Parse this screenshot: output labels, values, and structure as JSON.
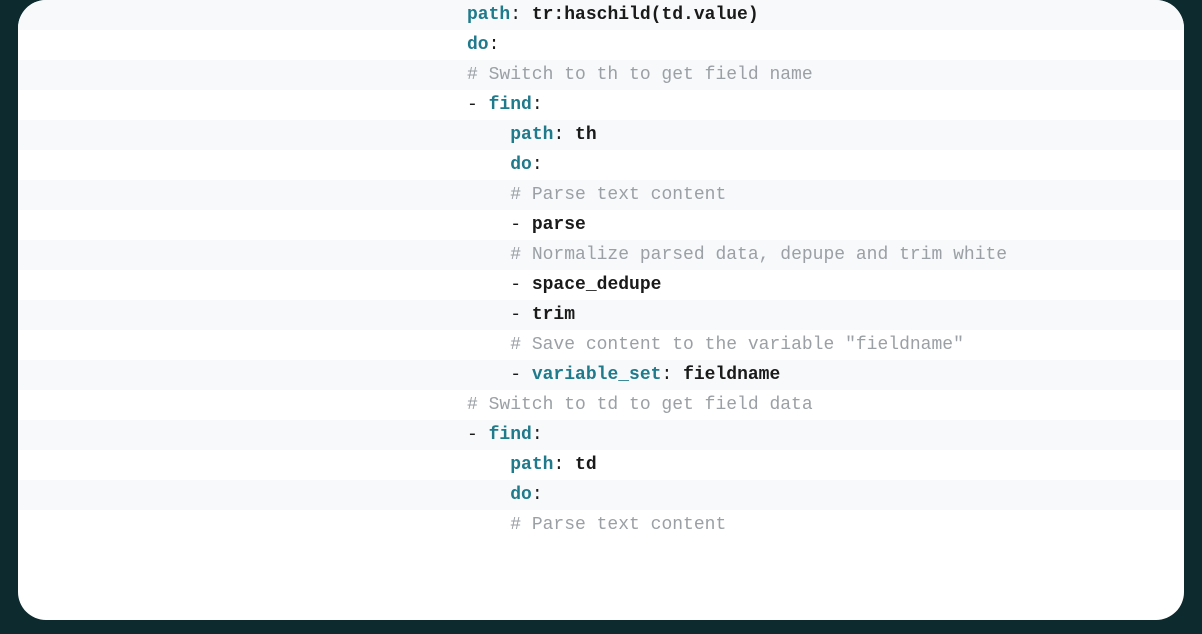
{
  "code": {
    "lines": [
      {
        "indent": 0,
        "type": "kv",
        "key": "path",
        "value": "tr:haschild(td.value)"
      },
      {
        "indent": 0,
        "type": "key_colon",
        "key": "do"
      },
      {
        "indent": 0,
        "type": "comment",
        "text": "# Switch to th to get field name"
      },
      {
        "indent": 0,
        "type": "list_key_colon",
        "key": "find"
      },
      {
        "indent": 2,
        "type": "kv",
        "key": "path",
        "value": "th"
      },
      {
        "indent": 2,
        "type": "key_colon",
        "key": "do"
      },
      {
        "indent": 2,
        "type": "comment",
        "text": "# Parse text content"
      },
      {
        "indent": 2,
        "type": "list_val",
        "value": "parse"
      },
      {
        "indent": 2,
        "type": "comment",
        "text": "# Normalize parsed data, depupe and trim white"
      },
      {
        "indent": 2,
        "type": "list_val",
        "value": "space_dedupe"
      },
      {
        "indent": 2,
        "type": "list_val",
        "value": "trim"
      },
      {
        "indent": 2,
        "type": "comment",
        "text": "# Save content to the variable \"fieldname\""
      },
      {
        "indent": 2,
        "type": "list_kv",
        "key": "variable_set",
        "value": "fieldname"
      },
      {
        "indent": 0,
        "type": "comment",
        "text": "# Switch to td to get field data"
      },
      {
        "indent": 0,
        "type": "list_key_colon",
        "key": "find"
      },
      {
        "indent": 2,
        "type": "kv",
        "key": "path",
        "value": "td"
      },
      {
        "indent": 2,
        "type": "key_colon",
        "key": "do"
      },
      {
        "indent": 2,
        "type": "comment",
        "text": "# Parse text content"
      }
    ]
  }
}
